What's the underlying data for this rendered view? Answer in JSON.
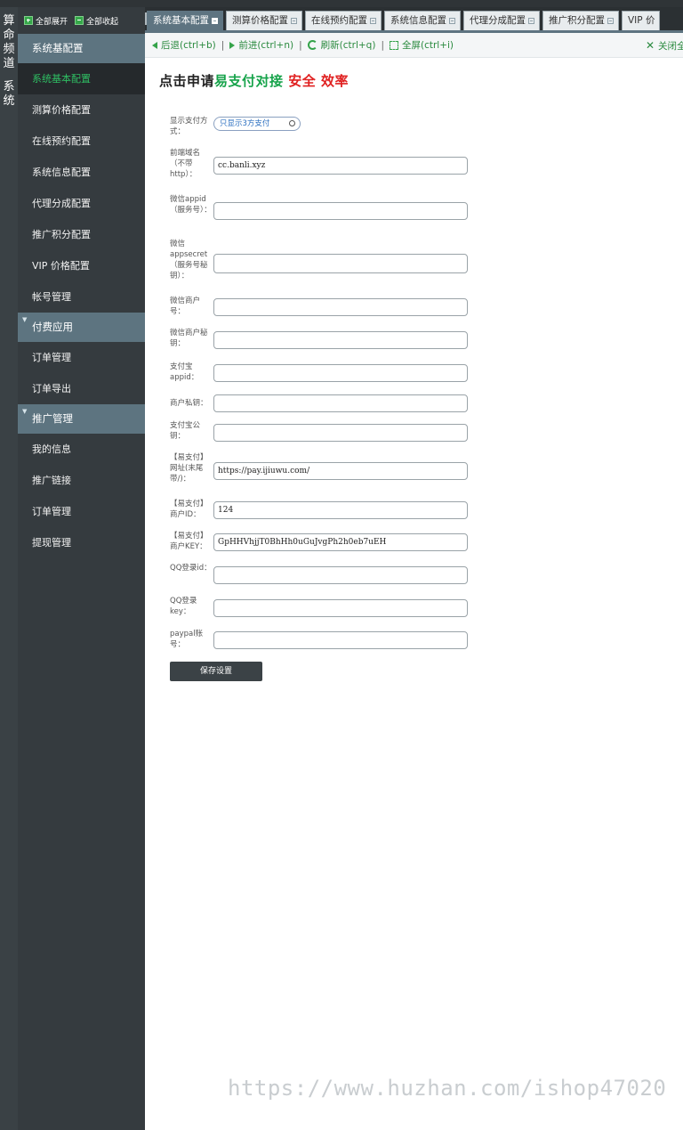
{
  "left_column": {
    "group1": [
      "算",
      "命",
      "频",
      "道"
    ],
    "group2": [
      "系",
      "统"
    ]
  },
  "sidebar": {
    "expand_all": "全部展开",
    "collapse_all": "全部收起",
    "groups": [
      {
        "title": "系统基配置",
        "items": [
          "系统基本配置",
          "测算价格配置",
          "在线预约配置",
          "系统信息配置",
          "代理分成配置",
          "推广积分配置",
          "VIP 价格配置",
          "帐号管理"
        ],
        "active_index": 0
      },
      {
        "title": "付费应用",
        "items": [
          "订单管理",
          "订单导出"
        ]
      },
      {
        "title": "推广管理",
        "items": [
          "我的信息",
          "推广链接",
          "订单管理",
          "提现管理"
        ]
      }
    ]
  },
  "tabs": [
    "系统基本配置",
    "测算价格配置",
    "在线预约配置",
    "系统信息配置",
    "代理分成配置",
    "推广积分配置",
    "VIP 价"
  ],
  "toolbar": {
    "back": "后退(ctrl+b)",
    "forward": "前进(ctrl+n)",
    "refresh": "刷新(ctrl+q)",
    "fullscreen": "全屏(ctrl+i)",
    "close_all": "关闭全部"
  },
  "headline": {
    "part1": "点击申请",
    "part2": "易支付对接",
    "part3": "安全 效率"
  },
  "form": {
    "pay_mode": {
      "label": "显示支付方式：",
      "value": "只显示3方支付"
    },
    "fields": [
      {
        "label": "前端域名（不带http）：",
        "value": "cc.banli.xyz"
      },
      {
        "label": "微信appid（服务号）：",
        "value": ""
      },
      {
        "label": "微信appsecret（服务号秘钥）：",
        "value": ""
      },
      {
        "label": "微信商户号：",
        "value": ""
      },
      {
        "label": "微信商户秘钥：",
        "value": ""
      },
      {
        "label": "支付宝appid：",
        "value": ""
      },
      {
        "label": "商户私钥：",
        "value": ""
      },
      {
        "label": "支付宝公钥：",
        "value": ""
      },
      {
        "label": "【易支付】网址(末尾带/)：",
        "value": "https://pay.ijiuwu.com/"
      },
      {
        "label": "【易支付】商户ID：",
        "value": "124"
      },
      {
        "label": "【易支付】商户KEY：",
        "value": "GpHHVhjjT0BhHh0uGuJvgPh2h0eb7uEH"
      },
      {
        "label": "QQ登录id：",
        "value": ""
      },
      {
        "label": "QQ登录key：",
        "value": ""
      },
      {
        "label": "paypal账号：",
        "value": ""
      }
    ],
    "save_label": "保存设置"
  },
  "watermark": "https://www.huzhan.com/ishop47020",
  "colors": {
    "accent_green": "#16a34a",
    "accent_red": "#e02020",
    "sidebar_bg": "#353b3f",
    "group_head": "#5d7480"
  }
}
